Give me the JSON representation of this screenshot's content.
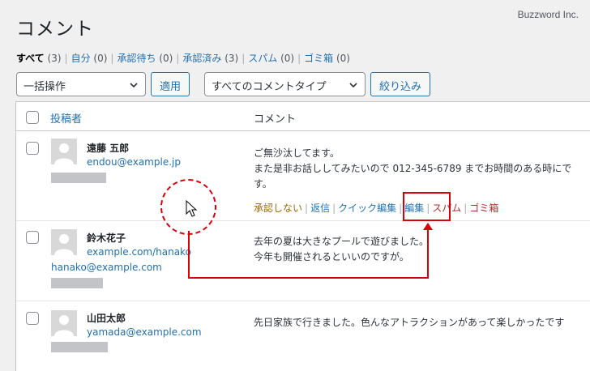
{
  "page": {
    "title": "コメント",
    "watermark": "Buzzword Inc."
  },
  "filters": [
    {
      "label": "すべて",
      "count": "(3)",
      "current": true
    },
    {
      "label": "自分",
      "count": "(0)"
    },
    {
      "label": "承認待ち",
      "count": "(0)"
    },
    {
      "label": "承認済み",
      "count": "(3)"
    },
    {
      "label": "スパム",
      "count": "(0)"
    },
    {
      "label": "ゴミ箱",
      "count": "(0)"
    }
  ],
  "toolbar": {
    "bulk_select": "一括操作",
    "apply_button": "適用",
    "type_select": "すべてのコメントタイプ",
    "filter_button": "絞り込み"
  },
  "table": {
    "col_author": "投稿者",
    "col_comment": "コメント",
    "rows": [
      {
        "author": "遠藤 五郎",
        "email": "endou@example.jp",
        "comment_lines": [
          "ご無沙汰してます。",
          "また是非お話ししてみたいので 012-345-6789 までお時間のある時にで",
          "す。"
        ],
        "actions": [
          "承認しない",
          "返信",
          "クイック編集",
          "編集",
          "スパム",
          "ゴミ箱"
        ]
      },
      {
        "author": "鈴木花子",
        "url": "example.com/hanako",
        "email": "hanako@example.com",
        "comment_lines": [
          "去年の夏は大きなプールで遊びました。",
          "今年も開催されるといいのですが。"
        ]
      },
      {
        "author": "山田太郎",
        "email": "yamada@example.com",
        "comment_lines": [
          "先日家族で行きました。色んなアトラクションがあって楽しかったです"
        ]
      }
    ]
  },
  "colors": {
    "annotation": "#d9000d",
    "link": "#2271b1"
  }
}
